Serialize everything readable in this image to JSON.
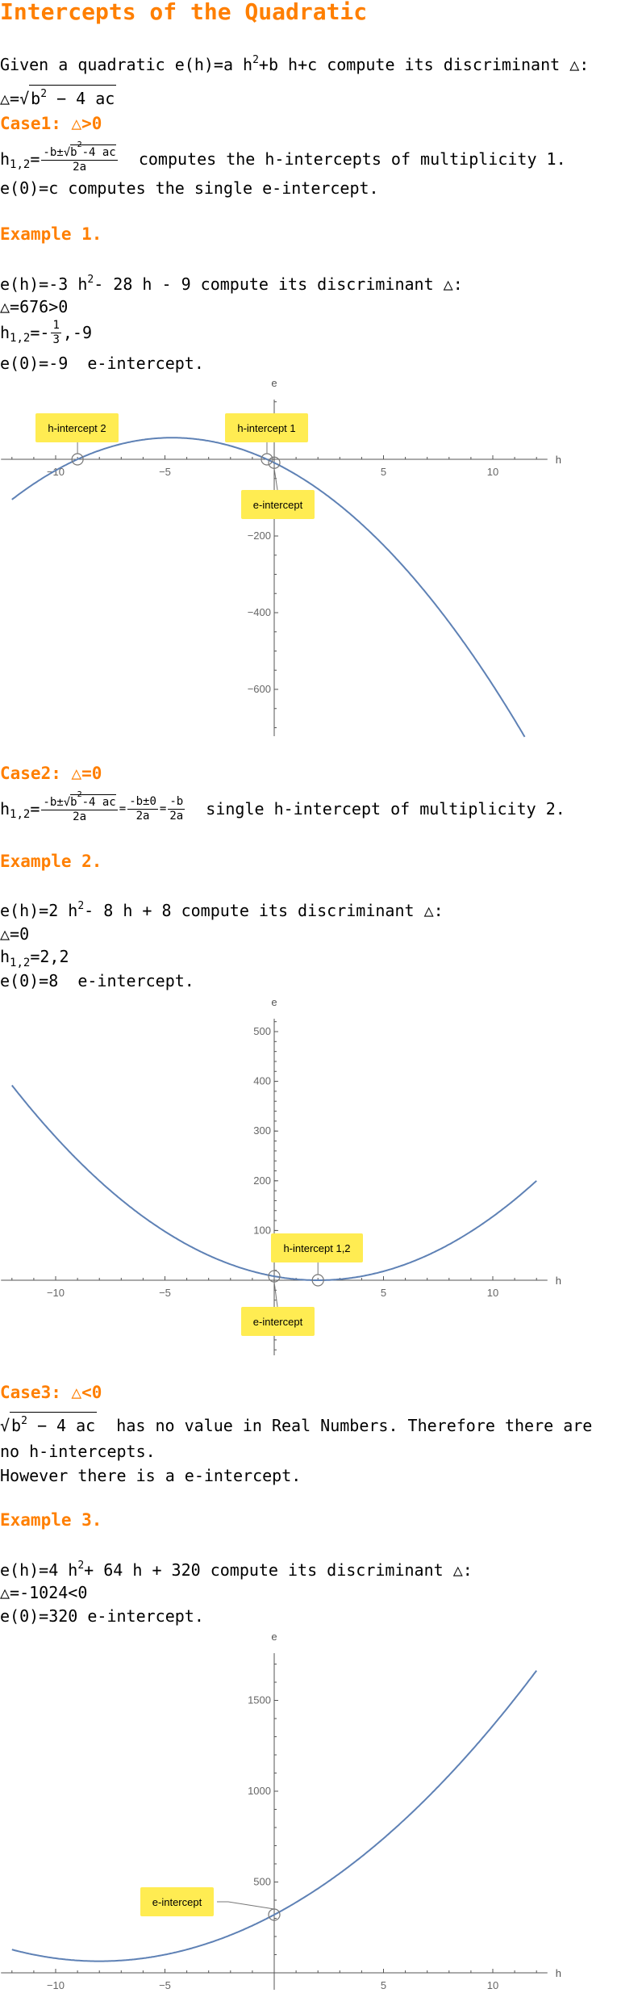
{
  "title": "Intercepts of the Quadratic",
  "intro": {
    "pre": "Given a quadratic ",
    "eq": "e(h)=a h",
    "sup": "2",
    "rest": "+b h+c",
    "post": " compute its discriminant △:"
  },
  "disc_def": {
    "lhs": "△=",
    "rad": "b",
    "sup": "2",
    "rest": " − 4 ac"
  },
  "case1": {
    "heading": "Case1: △>0",
    "h": "h",
    "sub": "1,2",
    "eq": "=",
    "num_pre": "-b±",
    "num_rad": "b",
    "num_sup": "2",
    "num_rest": "-4 ac",
    "den": "2a",
    "post": "  computes the h-intercepts of multiplicity 1.",
    "e_line": "e(0)=c computes the single e-intercept."
  },
  "example1": {
    "heading": "Example 1.",
    "eq": "e(h)=-3 h",
    "sup": "2",
    "rest": "- 28 h - 9 compute its discriminant △:",
    "disc": "△=676>0",
    "h": "h",
    "sub": "1,2",
    "h_eq": "=-",
    "frac_num": "1",
    "frac_den": "3",
    "h_rest": ",-9",
    "e_line": "e(0)=-9  e-intercept."
  },
  "case2": {
    "heading": "Case2: △=0",
    "h": "h",
    "sub": "1,2",
    "eq": "=",
    "num_pre": "-b±",
    "num_rad": "b",
    "num_sup": "2",
    "num_rest": "-4 ac",
    "den": "2a",
    "eq2": "=",
    "num2": "-b±0",
    "den2": "2a",
    "eq3": "=",
    "num3": "-b",
    "den3": "2a",
    "post": "  single h-intercept of multiplicity 2."
  },
  "example2": {
    "heading": "Example 2.",
    "eq": "e(h)=2 h",
    "sup": "2",
    "rest": "- 8 h + 8 compute its discriminant △:",
    "disc": "△=0",
    "h": "h",
    "sub": "1,2",
    "h_rest": "=2,2",
    "e_line": "e(0)=8  e-intercept."
  },
  "case3": {
    "heading": "Case3: △<0",
    "rad": "b",
    "sup": "2",
    "rest": " − 4 ac",
    "post": "  has no value in Real Numbers. Therefore there are",
    "line2": "no h-intercepts.",
    "line3": "However there is a e-intercept."
  },
  "example3": {
    "heading": "Example 3.",
    "eq": "e(h)=4 h",
    "sup": "2",
    "rest": "+ 64 h + 320 compute its discriminant △:",
    "disc": "△=-1024<0",
    "e_line": "e(0)=320 e-intercept."
  },
  "chart_data": [
    {
      "type": "line",
      "function": {
        "a": -3,
        "b": -28,
        "c": -9
      },
      "xlabel": "h",
      "ylabel": "e",
      "xlim": [
        -12.5,
        12.5
      ],
      "ylim": [
        -722,
        155
      ],
      "domain": [
        -12,
        12
      ],
      "xticks": [
        -10,
        -5,
        5,
        10
      ],
      "yticks": [
        -200,
        -400,
        -600
      ],
      "callouts": [
        {
          "label": "h-intercept 2",
          "point": [
            -9,
            0
          ]
        },
        {
          "label": "h-intercept 1",
          "point": [
            -0.333,
            0
          ]
        },
        {
          "label": "e-intercept",
          "point": [
            0,
            -9
          ]
        }
      ],
      "line_color": "#5e81b5",
      "callout_color": "#ffec52"
    },
    {
      "type": "line",
      "function": {
        "a": 2,
        "b": -8,
        "c": 8
      },
      "xlabel": "h",
      "ylabel": "e",
      "xlim": [
        -12.5,
        12.5
      ],
      "ylim": [
        -151,
        526
      ],
      "domain": [
        -12,
        12
      ],
      "xticks": [
        -10,
        -5,
        5,
        10
      ],
      "yticks": [
        500,
        400,
        300,
        200,
        100,
        -100
      ],
      "callouts": [
        {
          "label": "h-intercept 1,2",
          "point": [
            2,
            0
          ]
        },
        {
          "label": "e-intercept",
          "point": [
            0,
            8
          ]
        }
      ],
      "line_color": "#5e81b5",
      "callout_color": "#ffec52"
    },
    {
      "type": "line",
      "function": {
        "a": 4,
        "b": 64,
        "c": 320
      },
      "xlabel": "h",
      "ylabel": "e",
      "xlim": [
        -12.5,
        12.5
      ],
      "ylim": [
        0,
        1760
      ],
      "domain": [
        -12,
        12
      ],
      "xticks": [
        -10,
        -5,
        5,
        10
      ],
      "yticks": [
        1500,
        1000,
        500
      ],
      "callouts": [
        {
          "label": "e-intercept",
          "point": [
            0,
            320
          ]
        }
      ],
      "line_color": "#5e81b5",
      "callout_color": "#ffec52"
    }
  ]
}
